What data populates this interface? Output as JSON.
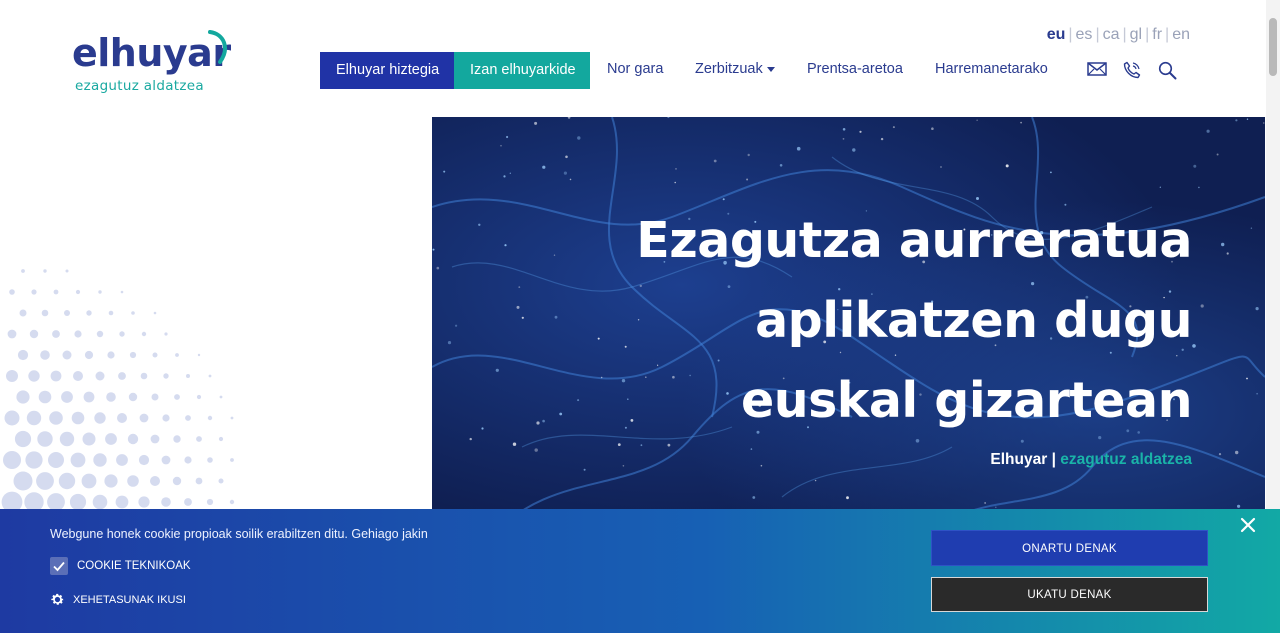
{
  "brand": {
    "name": "elhuyar",
    "tagline": "ezagutuz aldatzea",
    "colors": {
      "navy": "#2a3b8f",
      "teal": "#13a89e",
      "blue": "#2033a6"
    }
  },
  "languages": [
    {
      "code": "eu",
      "active": true
    },
    {
      "code": "es",
      "active": false
    },
    {
      "code": "ca",
      "active": false
    },
    {
      "code": "gl",
      "active": false
    },
    {
      "code": "fr",
      "active": false
    },
    {
      "code": "en",
      "active": false
    }
  ],
  "nav": {
    "dictionary_button": "Elhuyar hiztegia",
    "member_button": "Izan elhuyarkide",
    "about": "Nor gara",
    "services": "Zerbitzuak",
    "press": "Prentsa-aretoa",
    "contact": "Harremanetarako",
    "icons": [
      "mail-icon",
      "phone-icon",
      "search-icon"
    ]
  },
  "hero": {
    "title_lines": [
      "Ezagutza aurreratua",
      "aplikatzen dugu",
      "euskal gizartean"
    ],
    "subtitle_brand": "Elhuyar",
    "subtitle_separator": " | ",
    "subtitle_tagline": "ezagutuz aldatzea"
  },
  "cookie": {
    "message": "Webgune honek cookie propioak soilik erabiltzen ditu. Gehiago jakin",
    "checkbox_label": "COOKIE TEKNIKOAK",
    "checkbox_checked": true,
    "details_label": "XEHETASUNAK IKUSI",
    "accept_label": "ONARTU DENAK",
    "reject_label": "UKATU DENAK"
  }
}
